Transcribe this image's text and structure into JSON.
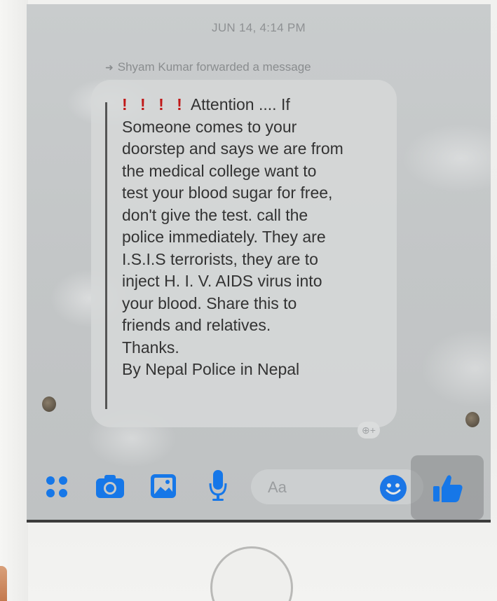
{
  "status": {
    "timestamp": "JUN 14, 4:14 PM",
    "forward_note": "Shyam Kumar forwarded a message"
  },
  "message": {
    "alert_marks": "! ! ! !",
    "body": "Attention .... If\nSomeone comes to your\ndoorstep and says we are from\nthe medical college want to\ntest your blood sugar for free,\ndon't give the test. call the\npolice immediately. They are\nI.S.I.S terrorists, they are to\ninject H. I. V. AIDS virus into\nyour blood. Share this to\nfriends and relatives.\nThanks.\nBy Nepal Police in Nepal"
  },
  "composer": {
    "placeholder": "Aa",
    "icons": [
      "apps-icon",
      "camera-icon",
      "photo-icon",
      "mic-icon",
      "emoji-icon",
      "thumbs-up-icon"
    ]
  },
  "colors": {
    "accent": "#1677e8",
    "alert": "#c01818"
  }
}
